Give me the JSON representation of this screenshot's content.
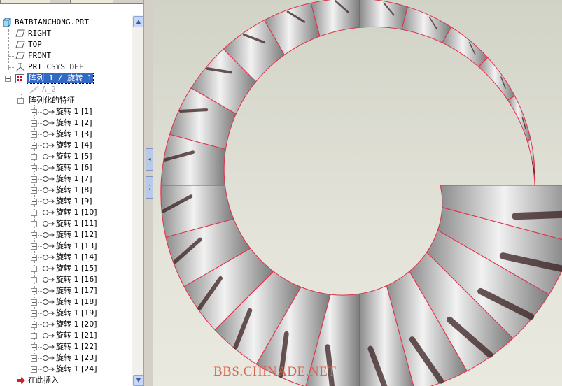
{
  "model_tree": {
    "root": "BAIBIANCHONG.PRT",
    "datum_planes": [
      "RIGHT",
      "TOP",
      "FRONT"
    ],
    "csys": "PRT_CSYS_DEF",
    "pattern_header": "阵列 1 / 旋转 1",
    "axis": "A_2",
    "patterned_features_label": "阵列化的特征",
    "features": [
      "旋转 1 [1]",
      "旋转 1 [2]",
      "旋转 1 [3]",
      "旋转 1 [4]",
      "旋转 1 [5]",
      "旋转 1 [6]",
      "旋转 1 [7]",
      "旋转 1 [8]",
      "旋转 1 [9]",
      "旋转 1 [10]",
      "旋转 1 [11]",
      "旋转 1 [12]",
      "旋转 1 [13]",
      "旋转 1 [14]",
      "旋转 1 [15]",
      "旋转 1 [16]",
      "旋转 1 [17]",
      "旋转 1 [18]",
      "旋转 1 [19]",
      "旋转 1 [20]",
      "旋转 1 [21]",
      "旋转 1 [22]",
      "旋转 1 [23]",
      "旋转 1 [24]"
    ],
    "insert_here": "在此插入"
  },
  "viewport": {
    "watermark": "BBS.CHINADE.NET",
    "segment_count": 24,
    "edge_color": "#e0304a"
  },
  "icons": {
    "part": "part-icon",
    "plane": "datum-plane-icon",
    "csys": "csys-icon",
    "pattern": "pattern-icon",
    "axis": "axis-icon",
    "revolve": "revolve-icon",
    "insert": "insert-arrow-icon"
  }
}
